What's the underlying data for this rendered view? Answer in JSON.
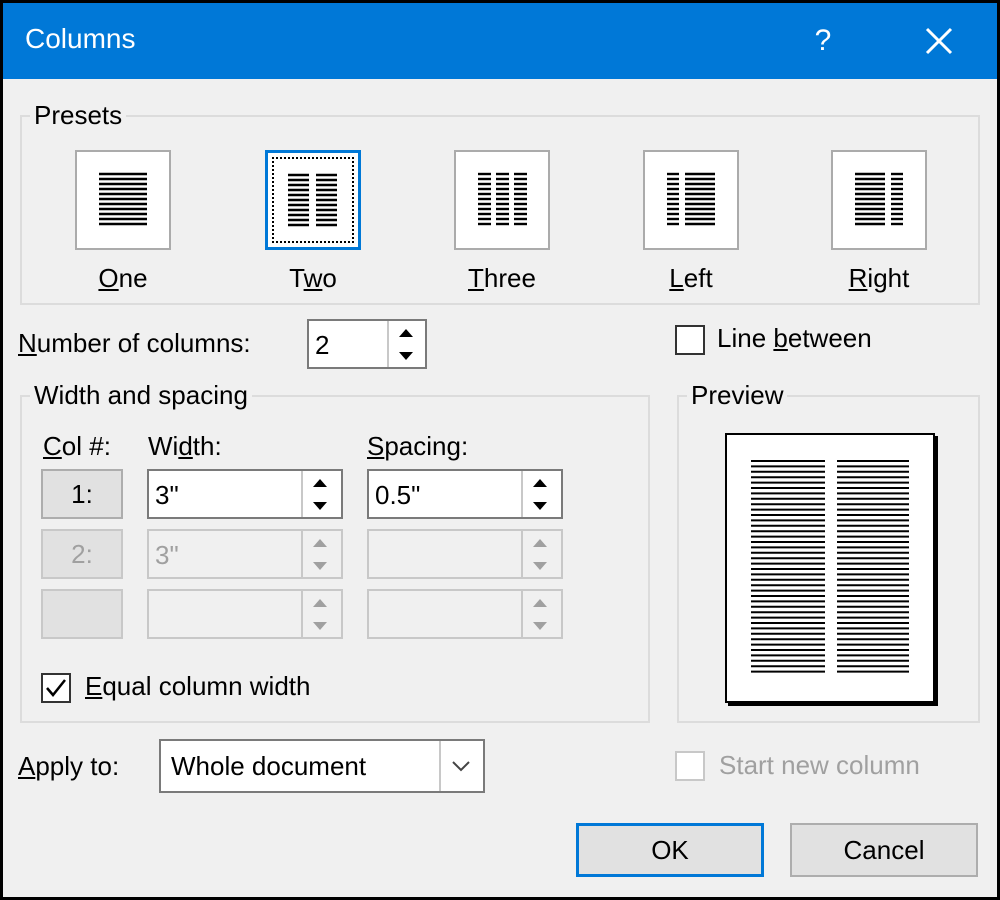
{
  "window": {
    "title": "Columns",
    "help_label": "?"
  },
  "presets": {
    "group_label": "Presets",
    "items": [
      {
        "label": "One",
        "underline": "O",
        "rest": "ne",
        "selected": false
      },
      {
        "label": "Two",
        "pre": "T",
        "underline": "w",
        "rest": "o",
        "selected": true
      },
      {
        "label": "Three",
        "underline": "T",
        "rest": "hree",
        "selected": false
      },
      {
        "label": "Left",
        "underline": "L",
        "rest": "eft",
        "selected": false
      },
      {
        "label": "Right",
        "underline": "R",
        "rest": "ight",
        "selected": false
      }
    ]
  },
  "number_of_columns": {
    "label_u": "N",
    "label_rest": "umber of columns:",
    "value": "2"
  },
  "line_between": {
    "label_pre": "Line ",
    "label_u": "b",
    "label_rest": "etween",
    "checked": false
  },
  "width_spacing": {
    "group_label": "Width and spacing",
    "col_header_u": "C",
    "col_header_rest": "ol #:",
    "width_header_pre": "Wi",
    "width_header_u": "d",
    "width_header_rest": "th:",
    "spacing_header_u": "S",
    "spacing_header_rest": "pacing:",
    "rows": [
      {
        "col": "1:",
        "width": "3\"",
        "spacing": "0.5\"",
        "enabled": true
      },
      {
        "col": "2:",
        "width": "3\"",
        "spacing": "",
        "enabled": false
      },
      {
        "col": "",
        "width": "",
        "spacing": "",
        "enabled": false
      }
    ]
  },
  "equal_column_width": {
    "label_u": "E",
    "label_rest": "qual column width",
    "checked": true
  },
  "preview": {
    "group_label": "Preview"
  },
  "apply_to": {
    "label_u": "A",
    "label_rest": "pply to:",
    "value": "Whole document"
  },
  "start_new_column": {
    "label": "Start new column",
    "checked": false,
    "enabled": false
  },
  "buttons": {
    "ok": "OK",
    "cancel": "Cancel"
  },
  "colors": {
    "titlebar": "#0078d7",
    "focus": "#0078d7",
    "background": "#f0f0f0"
  }
}
